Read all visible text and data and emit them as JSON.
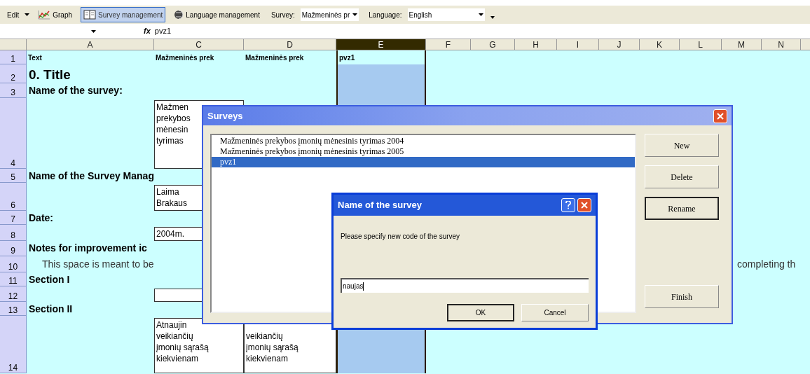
{
  "toolbar": {
    "menu": "Edit",
    "buttons": [
      {
        "kind": "graph",
        "label": "Graph",
        "selected": false
      },
      {
        "kind": "survey",
        "label": "Survey management",
        "selected": true
      },
      {
        "kind": "language",
        "label": "Language management",
        "selected": false
      }
    ],
    "survey_label": "Survey:",
    "survey_value": "Mažmeninės pr",
    "language_label": "Language:",
    "language_value": "English"
  },
  "formula_bar": {
    "function_label": "fx",
    "value": "pvz1"
  },
  "sheet": {
    "columns": [
      {
        "label": "A",
        "selected": false
      },
      {
        "label": "C",
        "selected": false
      },
      {
        "label": "D",
        "selected": false
      },
      {
        "label": "E",
        "selected": true
      },
      {
        "label": "F",
        "selected": false
      },
      {
        "label": "G",
        "selected": false
      },
      {
        "label": "H",
        "selected": false
      },
      {
        "label": "I",
        "selected": false
      },
      {
        "label": "J",
        "selected": false
      },
      {
        "label": "K",
        "selected": false
      },
      {
        "label": "L",
        "selected": false
      },
      {
        "label": "M",
        "selected": false
      },
      {
        "label": "N",
        "selected": false
      }
    ],
    "rows": [
      {
        "number": "1",
        "column_a": {
          "lines": [
            "Text"
          ],
          "kind": "header"
        },
        "column_c": {
          "lines": [
            "Mažmeninės prek"
          ],
          "kind": "header"
        },
        "column_d": {
          "lines": [
            "Mažmeninės prek"
          ],
          "kind": "header"
        },
        "column_e": {
          "lines": [
            "pvz1"
          ],
          "kind": "header"
        }
      },
      {
        "number": "2",
        "column_a": {
          "lines": [
            "0. Title"
          ],
          "kind": "title"
        }
      },
      {
        "number": "3",
        "column_a": {
          "lines": [
            "Name of the survey:"
          ],
          "kind": "heading"
        }
      },
      {
        "number": "4",
        "column_c": {
          "lines": [
            "Mažmen",
            "prekybos",
            "mėnesin",
            "tyrimas"
          ],
          "kind": "plain",
          "boxed": true
        }
      },
      {
        "number": "5",
        "column_a": {
          "lines": [
            "Name of the Survey Manag"
          ],
          "kind": "heading"
        }
      },
      {
        "number": "6",
        "column_c": {
          "lines": [
            "Laima",
            "Brakaus"
          ],
          "kind": "plain",
          "boxed": true
        }
      },
      {
        "number": "7",
        "column_a": {
          "lines": [
            "Date:"
          ],
          "kind": "heading"
        }
      },
      {
        "number": "8",
        "column_c": {
          "lines": [
            "2004m."
          ],
          "kind": "plain",
          "boxed": true
        }
      },
      {
        "number": "9",
        "column_a": {
          "lines": [
            "Notes for improvement ic"
          ],
          "kind": "heading"
        }
      },
      {
        "number": "10",
        "column_a": {
          "lines": [
            "This space is meant to be"
          ],
          "kind": "note"
        },
        "column_m": {
          "lines": [
            "completing th"
          ],
          "kind": "note"
        }
      },
      {
        "number": "11",
        "column_a": {
          "lines": [
            "Section I"
          ],
          "kind": "heading"
        }
      },
      {
        "number": "12",
        "column_c": {
          "boxed": true
        }
      },
      {
        "number": "13",
        "column_a": {
          "lines": [
            "Section II"
          ],
          "kind": "heading"
        }
      },
      {
        "number": "14",
        "column_c": {
          "lines": [
            "Atnaujin",
            "veikiančių",
            "įmonių sąrašą",
            "kiekvienam"
          ],
          "kind": "plain",
          "boxed": true
        },
        "column_d": {
          "lines": [
            "veikiančių",
            "įmonių sąrašą",
            "kiekvienam"
          ],
          "kind": "lower",
          "boxed": true
        }
      }
    ]
  },
  "surveys_dialog": {
    "title": "Surveys",
    "items": [
      {
        "label": "Mažmeninės prekybos įmonių mėnesinis tyrimas 2004",
        "selected": false
      },
      {
        "label": "Mažmeninės prekybos įmonių mėnesinis tyrimas 2005",
        "selected": false
      },
      {
        "label": "pvz1",
        "selected": true
      }
    ],
    "buttons": [
      {
        "label": "New",
        "focused": false
      },
      {
        "label": "Delete",
        "focused": false
      },
      {
        "label": "Rename",
        "focused": true
      },
      {
        "label": "Finish",
        "focused": false
      }
    ]
  },
  "name_dialog": {
    "title": "Name of the survey",
    "prompt": "Please specify new code of the survey",
    "input_value": "naujas",
    "buttons": [
      {
        "label": "OK",
        "focused": true
      },
      {
        "label": "Cancel",
        "focused": false
      }
    ]
  }
}
